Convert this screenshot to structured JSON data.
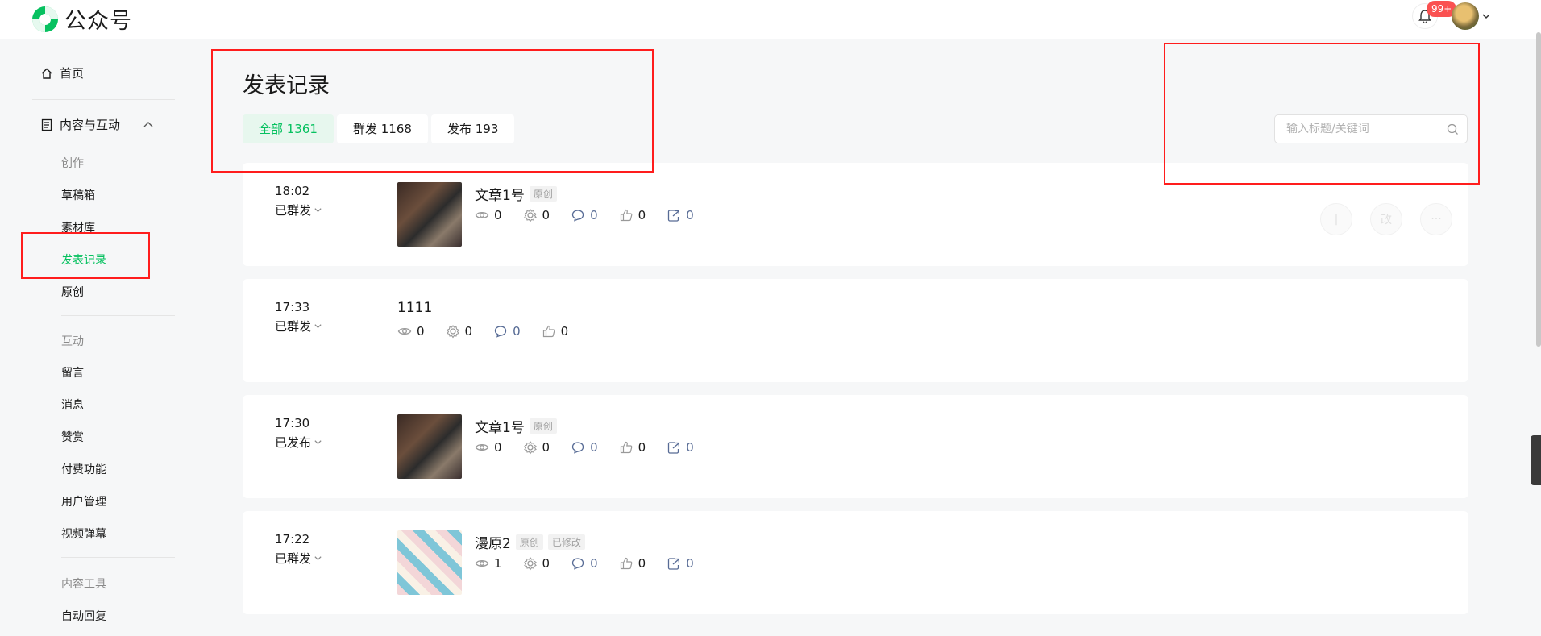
{
  "app": {
    "name": "公众号",
    "notification_count": "99+"
  },
  "sidebar": {
    "home": "首页",
    "content_section": "内容与互动",
    "groups": {
      "create": "创作",
      "interact": "互动",
      "tools": "内容工具"
    },
    "create_items": [
      "草稿箱",
      "素材库",
      "发表记录",
      "原创"
    ],
    "interact_items": [
      "留言",
      "消息",
      "赞赏",
      "付费功能",
      "用户管理",
      "视频弹幕"
    ],
    "tools_items": [
      "自动回复"
    ],
    "active_item": "发表记录"
  },
  "page": {
    "title": "发表记录"
  },
  "tabs": [
    {
      "label": "全部 1361",
      "active": true
    },
    {
      "label": "群发 1168",
      "active": false
    },
    {
      "label": "发布 193",
      "active": false
    }
  ],
  "search": {
    "placeholder": "输入标题/关键词"
  },
  "records": [
    {
      "time": "18:02",
      "status": "已群发",
      "title": "文章1号",
      "tags": [
        "原创"
      ],
      "thumb": "photo",
      "stats": [
        "0",
        "0",
        "0",
        "0",
        "0"
      ]
    },
    {
      "time": "17:33",
      "status": "已群发",
      "title": "1111",
      "tags": [],
      "thumb": null,
      "stats": [
        "0",
        "0",
        "0",
        "0"
      ]
    },
    {
      "time": "17:30",
      "status": "已发布",
      "title": "文章1号",
      "tags": [
        "原创"
      ],
      "thumb": "photo",
      "stats": [
        "0",
        "0",
        "0",
        "0",
        "0"
      ]
    },
    {
      "time": "17:22",
      "status": "已群发",
      "title": "漫原2",
      "tags": [
        "原创",
        "已修改"
      ],
      "thumb": "comic",
      "stats": [
        "1",
        "0",
        "0",
        "0",
        "0"
      ]
    }
  ],
  "card_actions": [
    "|",
    "改",
    "···"
  ],
  "colors": {
    "accent": "#07c160",
    "link": "#576b95",
    "badge": "#fa5151",
    "annotation": "#ff1d1d"
  }
}
